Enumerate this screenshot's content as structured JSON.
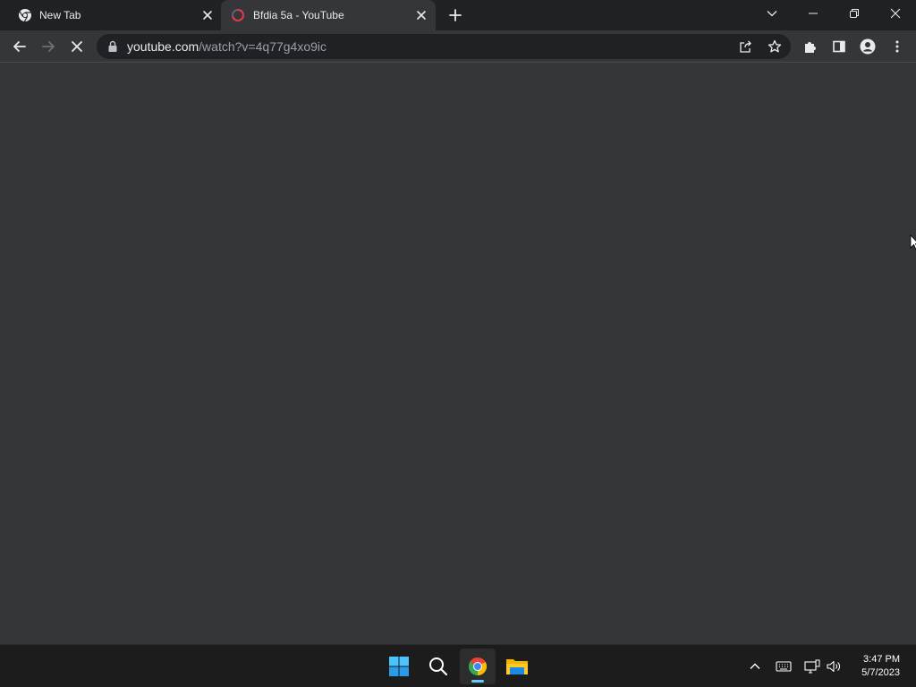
{
  "browser": {
    "tabs": [
      {
        "title": "New Tab",
        "active": false,
        "favicon": "chrome-icon"
      },
      {
        "title": "Bfdia 5a - YouTube",
        "active": true,
        "favicon": "loading-spinner-icon"
      }
    ],
    "address": {
      "host": "youtube.com",
      "path": "/watch?v=4q77g4xo9ic"
    },
    "colors": {
      "frame": "#202124",
      "toolbar": "#35363a",
      "text": "#e8eaed",
      "muted": "#9aa0a6",
      "loading_accent": "#e8334a"
    }
  },
  "taskbar": {
    "apps": [
      "windows-start-icon",
      "search-icon",
      "chrome-icon",
      "file-explorer-icon"
    ],
    "tray": [
      "chevron-up-icon",
      "keyboard-icon",
      "network-icon",
      "volume-icon"
    ],
    "clock": {
      "time": "3:47 PM",
      "date": "5/7/2023"
    },
    "accent": "#60cdff"
  }
}
